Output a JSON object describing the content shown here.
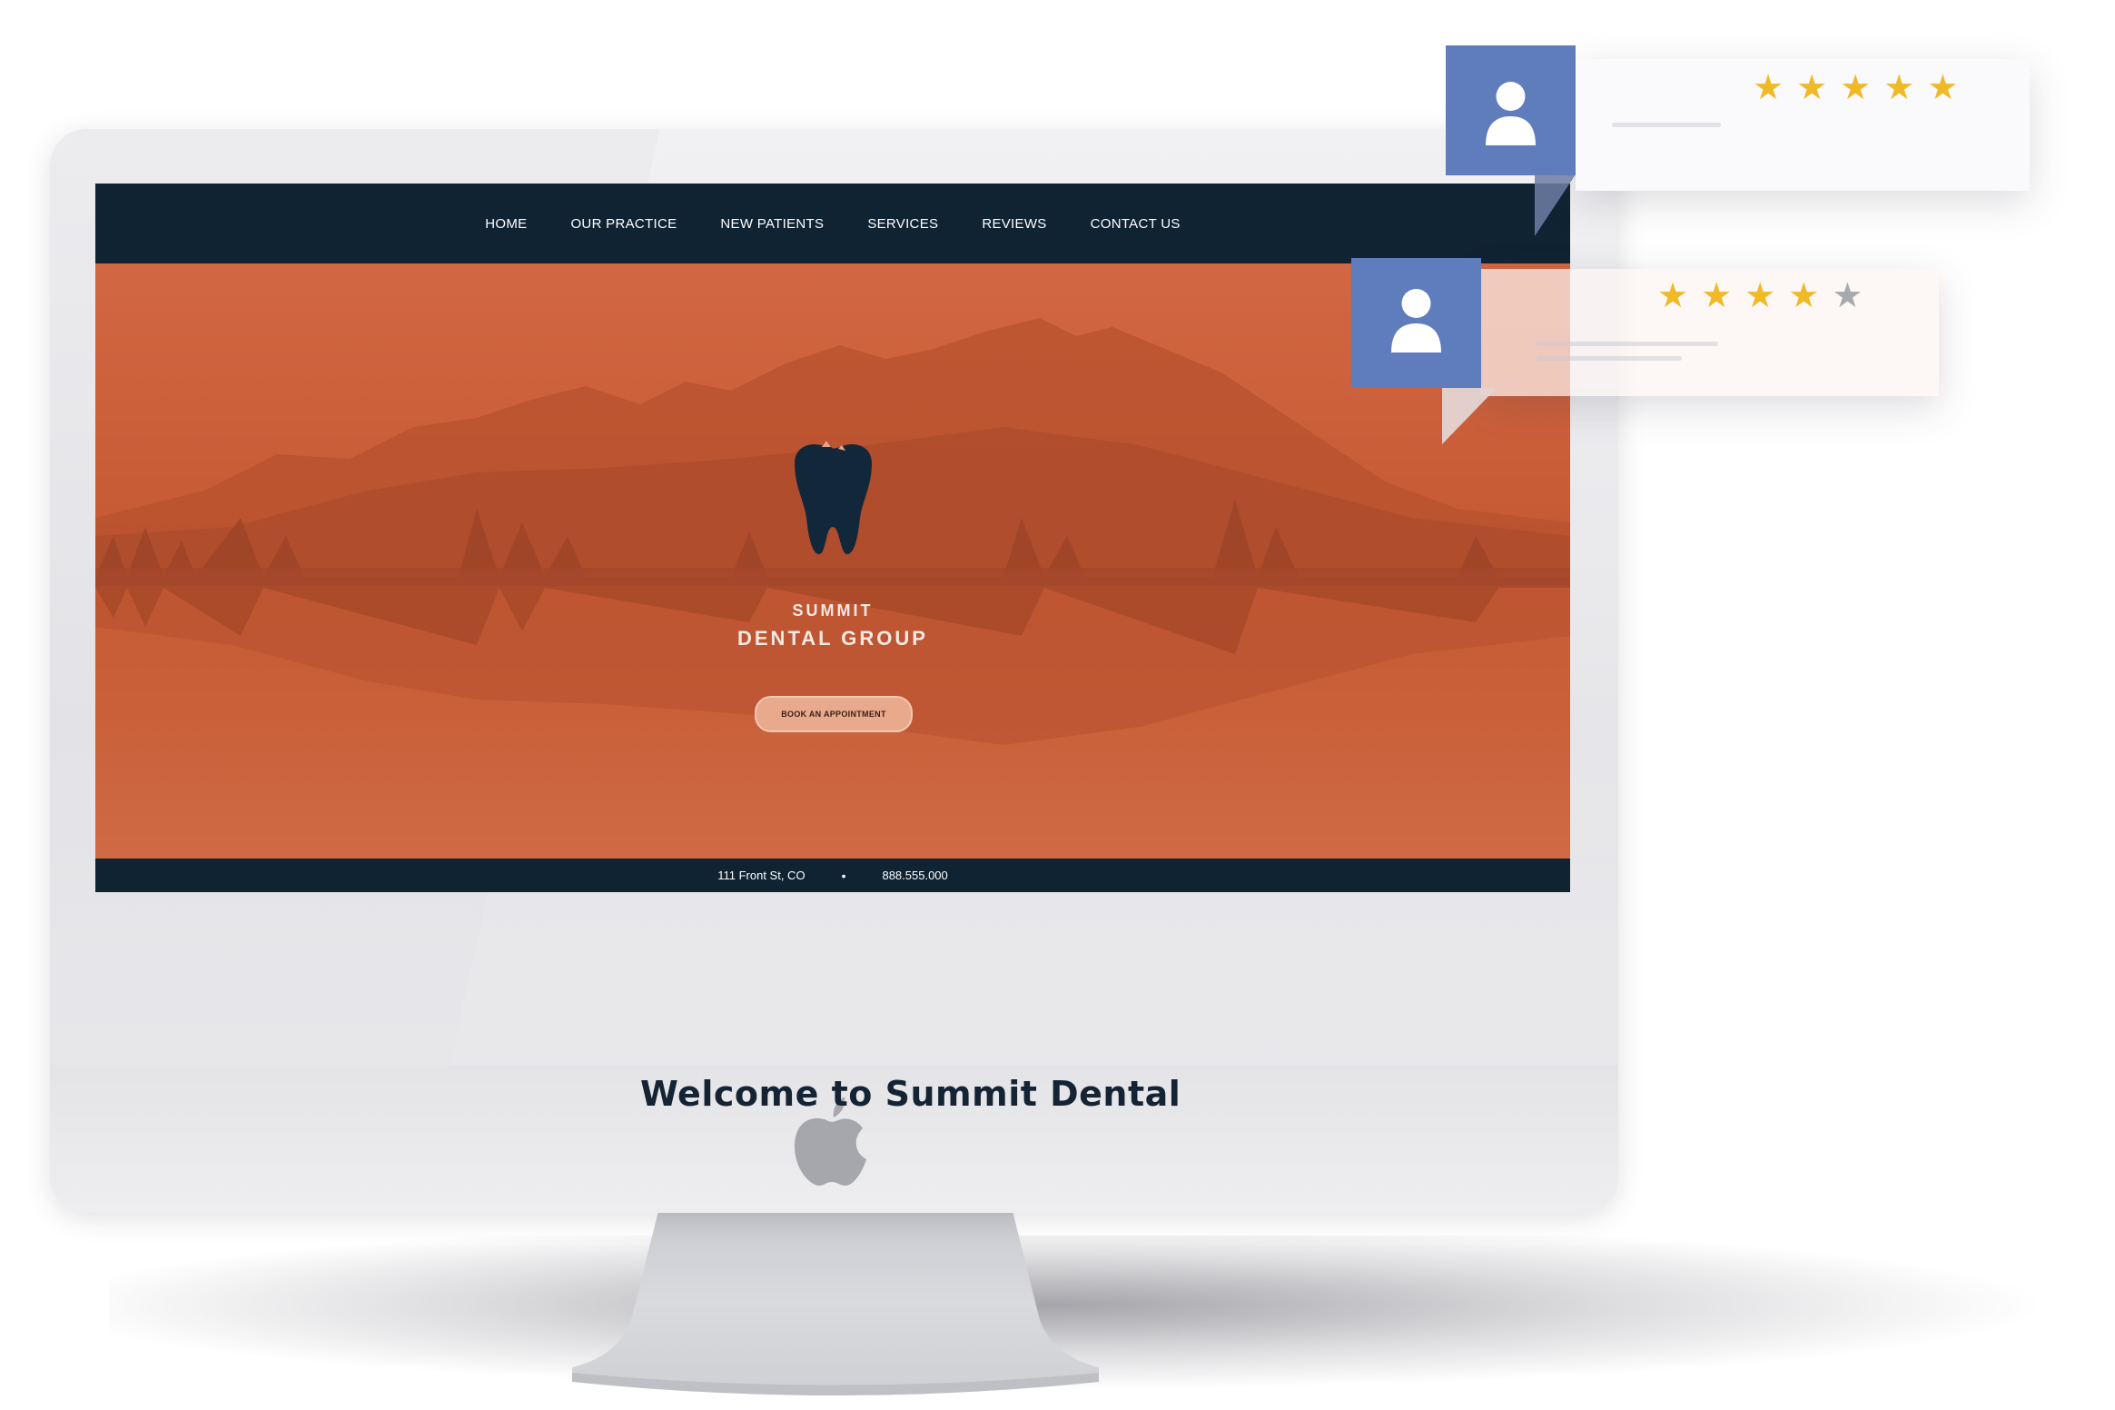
{
  "nav": {
    "items": [
      "HOME",
      "OUR PRACTICE",
      "NEW PATIENTS",
      "SERVICES",
      "REVIEWS",
      "CONTACT US"
    ]
  },
  "hero": {
    "brand_line1": "SUMMIT",
    "brand_line2": "DENTAL GROUP",
    "cta_label": "BOOK AN APPOINTMENT"
  },
  "footer": {
    "address": "111 Front St, CO",
    "separator": "•",
    "phone": "888.555.000"
  },
  "welcome_heading": "Welcome to Summit Dental",
  "reviews": [
    {
      "rating": 5,
      "max": 5,
      "icon": "user-icon"
    },
    {
      "rating": 4,
      "max": 5,
      "icon": "user-icon"
    }
  ],
  "colors": {
    "nav_bg": "#0f2333",
    "hero_orange": "#c9603a",
    "cta_bg": "#e8a98c",
    "avatar_blue": "#5f7cbd",
    "star_gold": "#f0b929",
    "star_gray": "#a8a9ad"
  }
}
